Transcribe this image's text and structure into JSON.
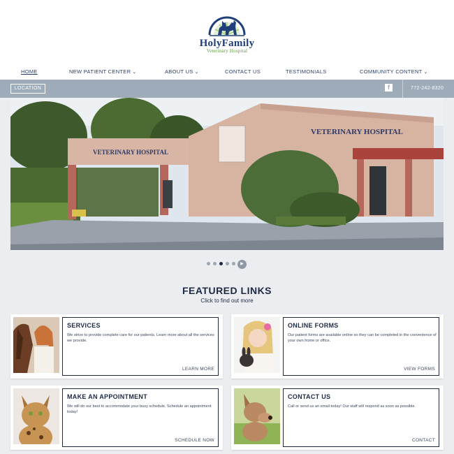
{
  "logo": {
    "brand": "HolyFamily",
    "sub": "Veterinary Hospital",
    "icon": "paw-pets-icon"
  },
  "nav": [
    {
      "label": "HOME",
      "active": true,
      "dropdown": false
    },
    {
      "label": "NEW PATIENT CENTER",
      "active": false,
      "dropdown": true
    },
    {
      "label": "ABOUT US",
      "active": false,
      "dropdown": true
    },
    {
      "label": "CONTACT US",
      "active": false,
      "dropdown": false
    },
    {
      "label": "TESTIMONIALS",
      "active": false,
      "dropdown": false
    },
    {
      "label": "COMMUNITY CONTENT",
      "active": false,
      "dropdown": true
    }
  ],
  "locbar": {
    "location_label": "LOCATION",
    "facebook_glyph": "f",
    "phone": "772-242-8320"
  },
  "hero": {
    "sign_main": "VETERINARY HOSPITAL",
    "sign_gate": "VETERINARY HOSPITAL"
  },
  "slider": {
    "play_glyph": "▶"
  },
  "featured": {
    "title": "FEATURED LINKS",
    "subtitle": "Click to find out more"
  },
  "cards": [
    {
      "title": "SERVICES",
      "text": "We strive to provide complete care for our patients. Learn more about all the services we provide.",
      "link": "LEARN MORE"
    },
    {
      "title": "ONLINE FORMS",
      "text": "Our patient forms are available online so they can be completed in the convenience of your own home or office.",
      "link": "VIEW FORMS"
    },
    {
      "title": "MAKE AN APPOINTMENT",
      "text": "We will do our best to accommodate your busy schedule. Schedule an appointment today!",
      "link": "SCHEDULE NOW"
    },
    {
      "title": "CONTACT US",
      "text": "Call or send us an email today! Our staff will respond as soon as possible.",
      "link": "CONTACT"
    }
  ],
  "colors": {
    "navy": "#1d2a44",
    "bar": "#9eacba",
    "green": "#5e9b3c",
    "logo_blue": "#1e3f78"
  }
}
